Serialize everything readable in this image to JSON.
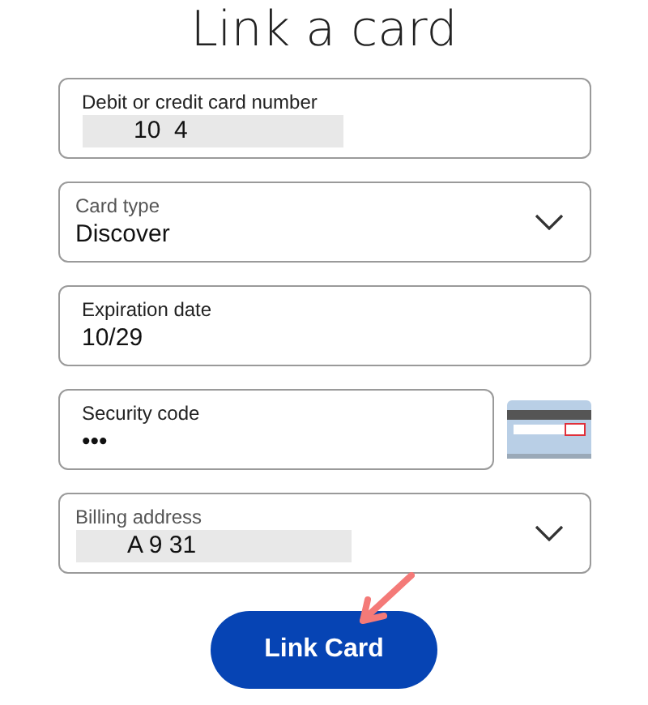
{
  "title": "Link a card",
  "fields": [
    {
      "kind": "text",
      "label": "Debit or credit card number",
      "value": "10  4",
      "redacted": true
    },
    {
      "kind": "select",
      "label": "Card type",
      "value": "Discover",
      "redacted": false
    },
    {
      "kind": "text",
      "label": "Expiration date",
      "value": "10/29",
      "redacted": false
    },
    {
      "kind": "secure",
      "label": "Security code",
      "value": "•••",
      "redacted": false
    },
    {
      "kind": "select",
      "label": "Billing address",
      "value": "A 9 31",
      "redacted": true
    }
  ],
  "button": "Link Card"
}
